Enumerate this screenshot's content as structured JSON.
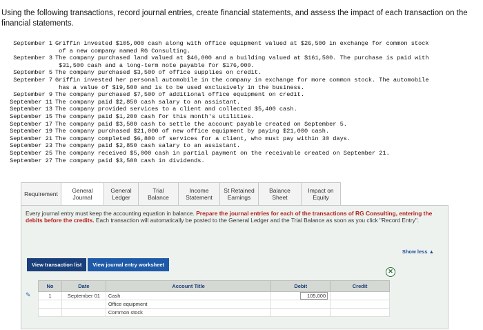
{
  "intro": {
    "text": "Using the following transactions, record journal entries, create financial statements, and assess the impact of each transaction on the financial statements."
  },
  "transactions": [
    {
      "date": "September 1",
      "text": "Griffin invested $105,000 cash along with office equipment valued at $26,500 in exchange for common stock\n of a new company named RG Consulting."
    },
    {
      "date": "September 3",
      "text": "The company purchased land valued at $46,000 and a building valued at $161,500. The purchase is paid with\n $31,500 cash and a long-term note payable for $176,000."
    },
    {
      "date": "September 5",
      "text": "The company purchased $3,500 of office supplies on credit."
    },
    {
      "date": "September 7",
      "text": "Griffin invested her personal automobile in the company in exchange for more common stock. The automobile\n has a value of $19,500 and is to be used exclusively in the business."
    },
    {
      "date": "September 9",
      "text": "The company purchased $7,500 of additional office equipment on credit."
    },
    {
      "date": "September 11",
      "text": "The company paid $2,850 cash salary to an assistant."
    },
    {
      "date": "September 13",
      "text": "The company provided services to a client and collected $5,400 cash."
    },
    {
      "date": "September 15",
      "text": "The company paid $1,200 cash for this month's utilities."
    },
    {
      "date": "September 17",
      "text": "The company paid $3,500 cash to settle the account payable created on September 5."
    },
    {
      "date": "September 19",
      "text": "The company purchased $21,000 of new office equipment by paying $21,000 cash."
    },
    {
      "date": "September 21",
      "text": "The company completed $6,800 of services for a client, who must pay within 30 days."
    },
    {
      "date": "September 23",
      "text": "The company paid $2,850 cash salary to an assistant."
    },
    {
      "date": "September 25",
      "text": "The company received $5,000 cash in partial payment on the receivable created on September 21."
    },
    {
      "date": "September 27",
      "text": "The company paid $3,500 cash in dividends."
    }
  ],
  "tabs": [
    {
      "label": "Requirement",
      "width": 58,
      "active": false
    },
    {
      "label": "General Journal",
      "width": 62,
      "active": true
    },
    {
      "label": "General Ledger",
      "width": 50,
      "active": false
    },
    {
      "label": "Trial Balance",
      "width": 58,
      "active": false
    },
    {
      "label": "Income Statement",
      "width": 60,
      "active": false
    },
    {
      "label": "St Retained Earnings",
      "width": 56,
      "active": false
    },
    {
      "label": "Balance Sheet",
      "width": 62,
      "active": false
    },
    {
      "label": "Impact on Equity",
      "width": 58,
      "active": false
    }
  ],
  "instructions": {
    "lead": "Every journal entry must keep the accounting equation in balance. ",
    "bold": "Prepare the journal entries for each of the transactions of RG Consulting, entering the debits before the credits.",
    "tail": " Each transaction will automatically be posted to the General Ledger and the Trial Balance as soon as you click \"Record Entry\"."
  },
  "show_less": "Show less ▲",
  "buttons": {
    "view_transaction_list": "View transaction list",
    "view_journal_worksheet": "View journal entry worksheet"
  },
  "journal": {
    "headers": {
      "no": "No",
      "date": "Date",
      "account": "Account Title",
      "debit": "Debit",
      "credit": "Credit"
    },
    "rows": [
      {
        "no": "1",
        "date": "September 01",
        "account": "Cash",
        "debit": "105,000",
        "credit": ""
      },
      {
        "no": "",
        "date": "",
        "account": "Office equipment",
        "debit": "",
        "credit": ""
      },
      {
        "no": "",
        "date": "",
        "account": "Common stock",
        "debit": "",
        "credit": ""
      }
    ]
  },
  "colors": {
    "accent": "#1e5aa8",
    "emphasis": "#b21f1f"
  }
}
